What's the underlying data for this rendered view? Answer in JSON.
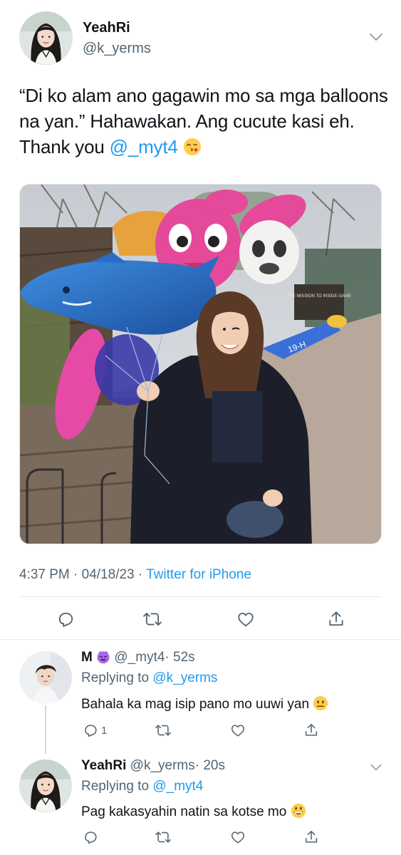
{
  "main_tweet": {
    "name": "YeahRi",
    "handle": "@k_yerms",
    "text_before": "“Di ko alam ano gagawin mo sa mga balloons na yan.” Hahawakan. Ang cucute kasi eh. Thank you ",
    "mention": "@_myt4",
    "timestamp": "4:37 PM · 04/18/23 · ",
    "source": "Twitter for iPhone",
    "photo_sign": "THE MISSION TO INSIDE-GAME",
    "balloon_text": "19-H"
  },
  "replies": [
    {
      "name": "M",
      "handle": "@_myt4",
      "time": "· 52s",
      "replying_label": "Replying to ",
      "replying_to": "@k_yerms",
      "text": "Bahala ka mag isip pano mo uuwi yan",
      "reply_count": "1"
    },
    {
      "name": "YeahRi",
      "handle": "@k_yerms",
      "time": "· 20s",
      "replying_label": "Replying to ",
      "replying_to": "@_myt4",
      "text": "Pag kakasyahin natin sa kotse mo",
      "reply_count": ""
    }
  ],
  "icons": [
    "reply-icon",
    "retweet-icon",
    "like-icon",
    "share-icon",
    "chevron-down-icon",
    "smiling-devil-emoji",
    "kiss-emoji",
    "neutral-face-emoji",
    "grin-emoji"
  ],
  "colors": {
    "accent": "#1d9bf0",
    "secondary_text": "#536471",
    "primary_text": "#0f1419",
    "divider": "#e6e9eb"
  }
}
